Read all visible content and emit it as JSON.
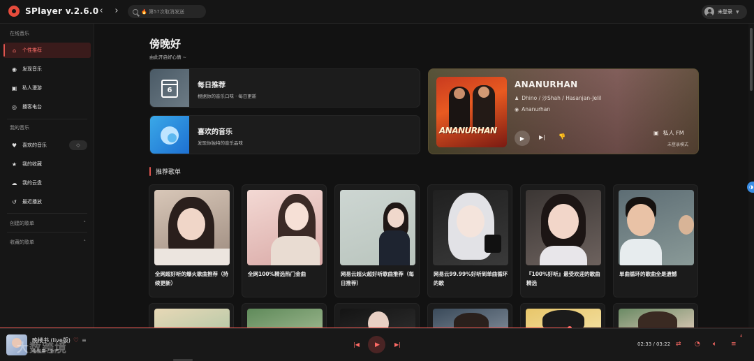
{
  "app": {
    "title": "SPlayer v.2.6.0"
  },
  "search": {
    "placeholder": "🔥 第57次取消发送 "
  },
  "user": {
    "label": "未登录"
  },
  "sidebar": {
    "online_section": "在线音乐",
    "my_section": "我的音乐",
    "items": [
      {
        "label": "个性推荐",
        "icon": "home-icon",
        "active": true
      },
      {
        "label": "发现音乐",
        "icon": "disc-icon"
      },
      {
        "label": "私人漫游",
        "icon": "radio-icon"
      },
      {
        "label": "播客电台",
        "icon": "podcast-icon"
      },
      {
        "label": "喜欢的音乐",
        "icon": "heart-icon"
      },
      {
        "label": "我的收藏",
        "icon": "star-icon"
      },
      {
        "label": "我的云盘",
        "icon": "cloud-icon"
      },
      {
        "label": "最近播放",
        "icon": "history-icon"
      }
    ],
    "created_playlists": "创建的歌单",
    "collected_playlists": "收藏的歌单"
  },
  "main": {
    "greeting": "傍晚好",
    "subgreeting": "由此开启好心情 ~",
    "daily": {
      "title": "每日推荐",
      "desc": "根据你的音乐口味 · 每日更新",
      "day": "6"
    },
    "liked": {
      "title": "喜欢的音乐",
      "desc": "发现你独特的音乐品味"
    },
    "fm": {
      "song": "ANANURHAN",
      "artists": "Dhino / 沙Shah / Hasanjan-Jelil",
      "album": "Ananurhan",
      "cover_text": "ANANURHAN",
      "label": "私人 FM",
      "sub": "未登录模式"
    },
    "section_title": "推荐歌单",
    "playlists": [
      {
        "name": "全网超好听的爆火歌曲推荐（持续更新）"
      },
      {
        "name": "全网100%精选热门金曲"
      },
      {
        "name": "网易云超火超好听歌曲推荐（每日推荐）"
      },
      {
        "name": "网易云99.99%好听到单曲循环的歌"
      },
      {
        "name": "『100%好听』最受欢迎的歌曲精选"
      },
      {
        "name": "单曲循环的歌曲全是遗憾"
      }
    ]
  },
  "player": {
    "title": "晚楼书 (live版)",
    "artist": "张碧晨 / 张杰",
    "time": "02:33 / 03:22",
    "progress": 0.756,
    "queue_count": "4",
    "watermark": "大数跨境"
  },
  "colors": {
    "accent": "#e0554f",
    "background": "#121212"
  }
}
